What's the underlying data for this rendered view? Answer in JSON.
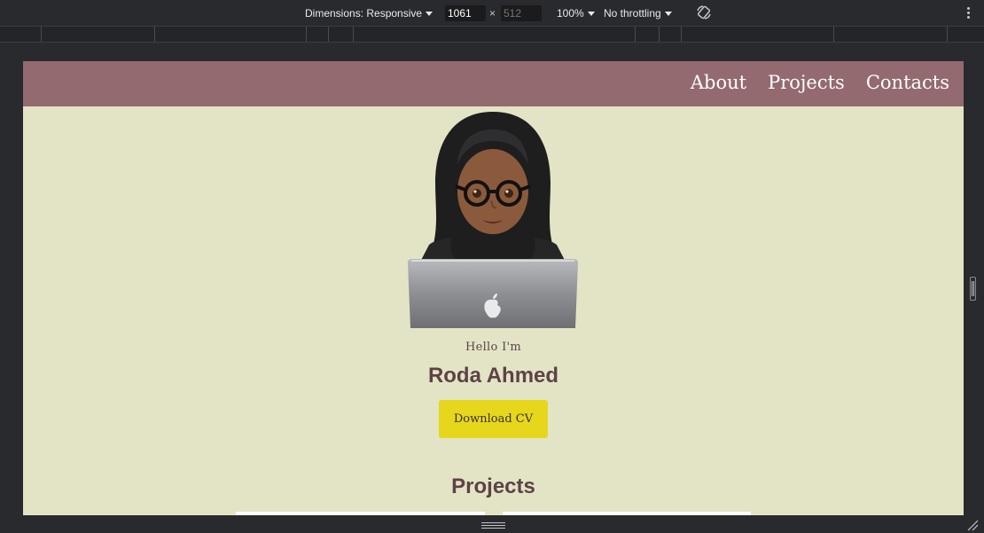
{
  "devtools": {
    "dimensions_label": "Dimensions: Responsive",
    "width_value": "1061",
    "height_placeholder": "512",
    "times": "×",
    "zoom": "100%",
    "throttling": "No throttling",
    "colors": {
      "toolbar_bg": "#292a2d",
      "text": "#e8eaed"
    }
  },
  "site": {
    "nav": {
      "about": "About",
      "projects": "Projects",
      "contacts": "Contacts"
    },
    "hero": {
      "greeting": "Hello I'm",
      "name": "Roda Ahmed",
      "cv_button": "Download CV",
      "avatar_icon": "woman-with-hijab-at-laptop-emoji"
    },
    "projects_title": "Projects",
    "colors": {
      "header": "#936a6f",
      "background": "#e3e4c5",
      "button": "#e6d71d",
      "heading": "#5c4346"
    }
  }
}
